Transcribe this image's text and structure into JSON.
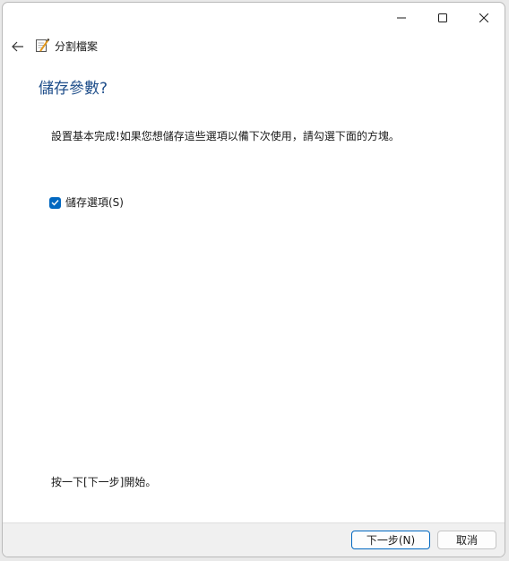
{
  "window": {
    "app_title": "分割檔案",
    "app_icon": "notepad-pen-icon",
    "caption_icons": [
      "minimize-icon",
      "maximize-icon",
      "close-icon"
    ],
    "back_icon": "back-arrow-icon"
  },
  "page": {
    "heading": "儲存參數?",
    "description": "設置基本完成!如果您想儲存這些選項以備下次使用，請勾選下面的方塊。",
    "checkbox": {
      "label": "儲存選項(S)",
      "checked": true
    },
    "hint": "按一下[下一步]開始。"
  },
  "footer": {
    "next_label": "下一步(N)",
    "cancel_label": "取消"
  },
  "colors": {
    "accent": "#0067c0",
    "heading": "#1f4e8a",
    "footer_bg": "#f0f0f0"
  }
}
